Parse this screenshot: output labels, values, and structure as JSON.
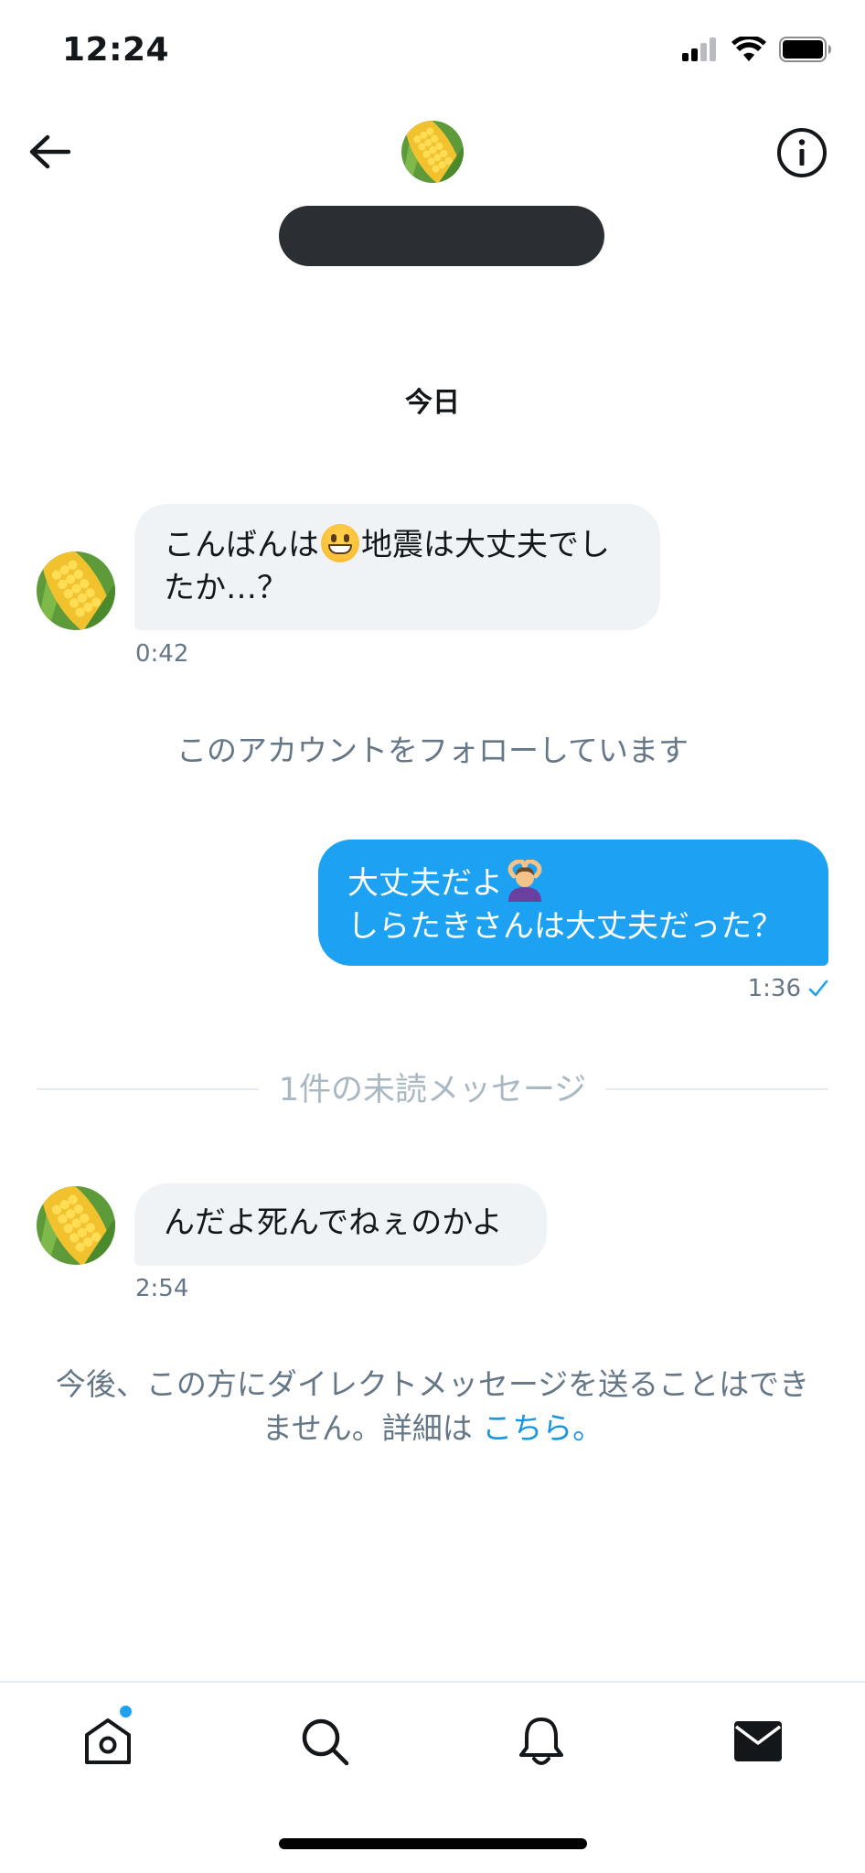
{
  "status_bar": {
    "time": "12:24",
    "icons": [
      "cellular-signal-icon",
      "wifi-icon",
      "battery-icon"
    ]
  },
  "header": {
    "back_icon": "arrow-left-icon",
    "info_icon": "info-circle-icon",
    "avatar": "corn-avatar"
  },
  "conversation": {
    "date_separator": "今日",
    "messages": [
      {
        "direction": "incoming",
        "line1_before_emoji": "こんばんは",
        "emoji": "grinning-face-emoji",
        "line1_after_emoji": "地震は大丈夫でし",
        "line2": "たか…？",
        "time": "0:42"
      },
      {
        "direction": "outgoing",
        "line1": "大丈夫だよ",
        "emoji": "person-gesturing-ok-emoji",
        "line2": "しらたきさんは大丈夫だった？",
        "time": "1:36",
        "read_icon": "checkmark-icon"
      },
      {
        "direction": "incoming",
        "text": "んだよ死んでねぇのかよ",
        "time": "2:54"
      }
    ],
    "follow_notice": "このアカウントをフォローしています",
    "unread_divider": "1件の未読メッセージ",
    "blocked_notice_line1": "今後、この方にダイレクトメッセージを送ることはでき",
    "blocked_notice_line2": "ません。詳細は",
    "blocked_notice_link": "こちら。"
  },
  "colors": {
    "accent": "#1da1f2",
    "link": "#1b95e0",
    "incoming_bubble": "#eff3f5",
    "muted_text": "#657786"
  },
  "bottom_nav": {
    "items": [
      "home-icon",
      "search-icon",
      "notifications-bell-icon",
      "messages-envelope-icon"
    ],
    "active": "messages-envelope-icon",
    "home_has_new": true
  }
}
